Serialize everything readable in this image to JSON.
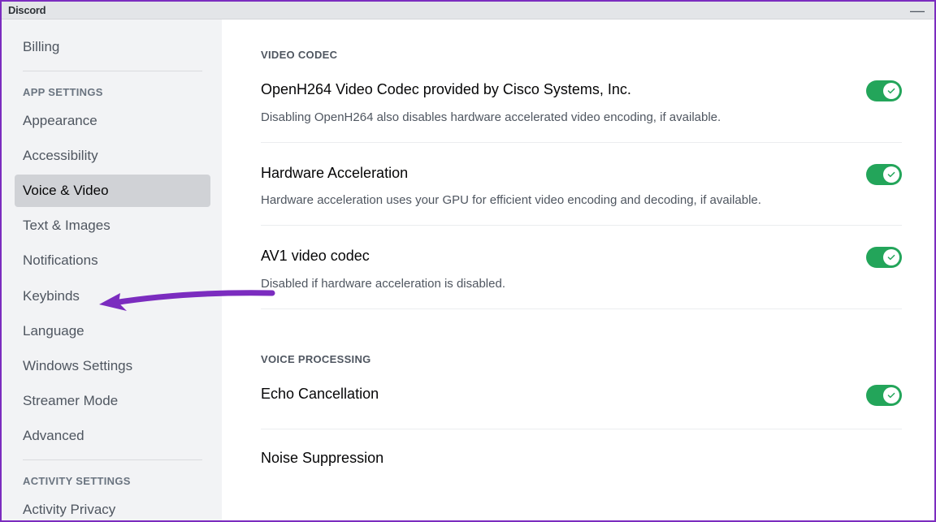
{
  "titlebar": {
    "app_name": "Discord"
  },
  "sidebar": {
    "top_items": [
      {
        "label": "Billing"
      }
    ],
    "categories": [
      {
        "header": "APP SETTINGS",
        "items": [
          {
            "label": "Appearance",
            "active": false
          },
          {
            "label": "Accessibility",
            "active": false
          },
          {
            "label": "Voice & Video",
            "active": true
          },
          {
            "label": "Text & Images",
            "active": false
          },
          {
            "label": "Notifications",
            "active": false
          },
          {
            "label": "Keybinds",
            "active": false
          },
          {
            "label": "Language",
            "active": false
          },
          {
            "label": "Windows Settings",
            "active": false
          },
          {
            "label": "Streamer Mode",
            "active": false
          },
          {
            "label": "Advanced",
            "active": false
          }
        ]
      },
      {
        "header": "ACTIVITY SETTINGS",
        "items": [
          {
            "label": "Activity Privacy",
            "active": false
          }
        ]
      }
    ]
  },
  "content": {
    "sections": [
      {
        "header": "VIDEO CODEC",
        "settings": [
          {
            "title": "OpenH264 Video Codec provided by Cisco Systems, Inc.",
            "desc": "Disabling OpenH264 also disables hardware accelerated video encoding, if available.",
            "toggle": true
          },
          {
            "title": "Hardware Acceleration",
            "desc": "Hardware acceleration uses your GPU for efficient video encoding and decoding, if available.",
            "toggle": true
          },
          {
            "title": "AV1 video codec",
            "desc": "Disabled if hardware acceleration is disabled.",
            "toggle": true
          }
        ]
      },
      {
        "header": "VOICE PROCESSING",
        "settings": [
          {
            "title": "Echo Cancellation",
            "desc": "",
            "toggle": true
          },
          {
            "title": "Noise Suppression",
            "desc": "",
            "toggle": null
          }
        ]
      }
    ]
  },
  "colors": {
    "accent": "#23a55a",
    "annotation": "#7b2cbf"
  }
}
